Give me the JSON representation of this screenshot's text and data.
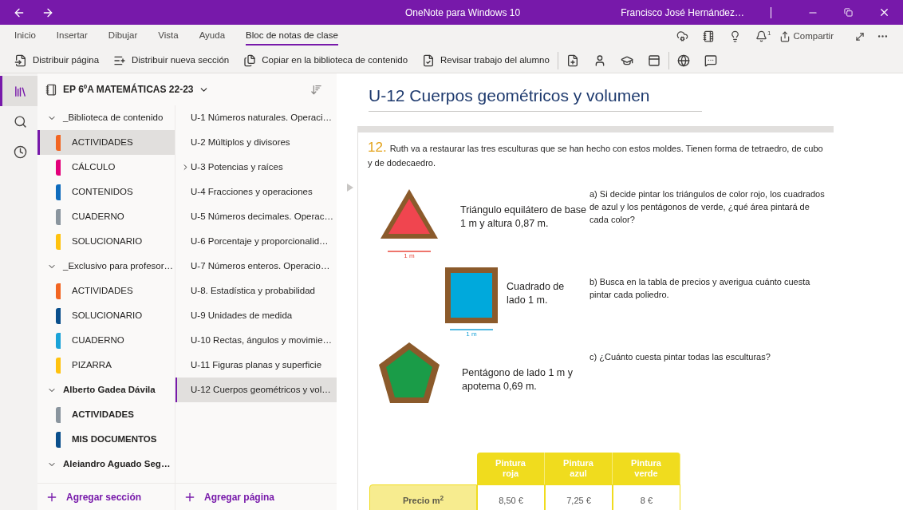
{
  "window": {
    "title": "OneNote para Windows 10",
    "user": "Francisco José Hernández…"
  },
  "menu_tabs": [
    {
      "label": "Inicio",
      "selected": false
    },
    {
      "label": "Insertar",
      "selected": false
    },
    {
      "label": "Dibujar",
      "selected": false
    },
    {
      "label": "Vista",
      "selected": false
    },
    {
      "label": "Ayuda",
      "selected": false
    },
    {
      "label": "Bloc de notas de clase",
      "selected": true
    }
  ],
  "notification_count": "1",
  "share_label": "Compartir",
  "ribbon": [
    {
      "kind": "distribute-page",
      "label": "Distribuir página"
    },
    {
      "kind": "distribute-section",
      "label": "Distribuir nueva sección"
    },
    {
      "kind": "copy-library",
      "label": "Copiar en la biblioteca de contenido"
    },
    {
      "kind": "review",
      "label": "Revisar trabajo del alumno"
    }
  ],
  "rail": [
    {
      "kind": "notebooks",
      "selected": true
    },
    {
      "kind": "search",
      "selected": false
    },
    {
      "kind": "recent",
      "selected": false
    }
  ],
  "notebook": {
    "name": "EP 6ºA MATEMÁTICAS 22-23"
  },
  "section_groups": [
    {
      "label": "_Biblioteca de contenido",
      "expanded": true,
      "unread": false,
      "children": [
        {
          "label": "ACTIVIDADES",
          "color": "#f26522",
          "selected": true,
          "unread": false
        },
        {
          "label": "CÁLCULO",
          "color": "#e3007a",
          "selected": false,
          "unread": false
        },
        {
          "label": "CONTENIDOS",
          "color": "#0f6cbd",
          "selected": false,
          "unread": false
        },
        {
          "label": "CUADERNO",
          "color": "#8a959e",
          "selected": false,
          "unread": false
        },
        {
          "label": "SOLUCIONARIO",
          "color": "#ffc20e",
          "selected": false,
          "unread": false
        }
      ]
    },
    {
      "label": "_Exclusivo para profesor…",
      "expanded": true,
      "unread": false,
      "children": [
        {
          "label": "ACTIVIDADES",
          "color": "#f26522",
          "selected": false,
          "unread": false
        },
        {
          "label": "SOLUCIONARIO",
          "color": "#0a4f8c",
          "selected": false,
          "unread": false
        },
        {
          "label": "CUADERNO",
          "color": "#1aa3d8",
          "selected": false,
          "unread": false
        },
        {
          "label": "PIZARRA",
          "color": "#ffc20e",
          "selected": false,
          "unread": false
        }
      ]
    },
    {
      "label": "Alberto Gadea Dávila",
      "expanded": true,
      "unread": true,
      "children": [
        {
          "label": "ACTIVIDADES",
          "color": "#8a959e",
          "selected": false,
          "unread": true
        },
        {
          "label": "MIS DOCUMENTOS",
          "color": "#0a4f8c",
          "selected": false,
          "unread": true
        }
      ]
    },
    {
      "label": "Aleiandro Aguado Seg…",
      "expanded": true,
      "unread": true
    }
  ],
  "add_section": "Agregar sección",
  "pages": [
    {
      "label": "U-1 Números naturales. Operaci…",
      "selected": false,
      "collapsed_subpages": false
    },
    {
      "label": "U-2 Múltiplos y divisores",
      "selected": false,
      "collapsed_subpages": false
    },
    {
      "label": "U-3 Potencias y raíces",
      "selected": false,
      "collapsed_subpages": true
    },
    {
      "label": "U-4 Fracciones y operaciones",
      "selected": false,
      "collapsed_subpages": false
    },
    {
      "label": "U-5 Números decimales. Operac…",
      "selected": false,
      "collapsed_subpages": false
    },
    {
      "label": "U-6 Porcentaje y proporcionalid…",
      "selected": false,
      "collapsed_subpages": false
    },
    {
      "label": "U-7 Números enteros. Operacio…",
      "selected": false,
      "collapsed_subpages": false
    },
    {
      "label": "U-8. Estadística y probabilidad",
      "selected": false,
      "collapsed_subpages": false
    },
    {
      "label": "U-9 Unidades de medida",
      "selected": false,
      "collapsed_subpages": false
    },
    {
      "label": "U-10 Rectas, ángulos y movimie…",
      "selected": false,
      "collapsed_subpages": false
    },
    {
      "label": "U-11 Figuras planas y superficie",
      "selected": false,
      "collapsed_subpages": false
    },
    {
      "label": "U-12 Cuerpos geométricos y vol…",
      "selected": true,
      "collapsed_subpages": false
    }
  ],
  "add_page": "Agregar página",
  "page": {
    "title": "U-12 Cuerpos geométricos y volumen",
    "exercise_number": "12.",
    "statement": "Ruth va a restaurar las tres esculturas que se han hecho con estos moldes. Tienen forma de tetraedro, de cubo y de dodecaedro.",
    "rows": [
      {
        "kind": "triangle",
        "caption": "Triángulo equilátero de base 1 m y altura 0,87 m.",
        "measure": "1 m",
        "question": "a) Si decide pintar los triángulos de color rojo, los cuadrados de azul y los pentágonos de verde, ¿qué área pintará de cada color?"
      },
      {
        "kind": "square",
        "caption": "Cuadrado de lado 1 m.",
        "measure": "1 m",
        "question": "b) Busca en la tabla de precios y averigua cuánto cuesta pintar cada poliedro."
      },
      {
        "kind": "pentagon",
        "caption": "Pentágono de lado 1 m y apotema 0,69 m.",
        "question": "c) ¿Cuánto cuesta pintar todas las esculturas?"
      }
    ],
    "price_table": {
      "columns": [
        "Pintura roja",
        "Pintura azul",
        "Pintura verde"
      ],
      "row_label": "Precio m$^{2}$",
      "values": [
        "8,50 €",
        "7,25 €",
        "8 €"
      ]
    }
  }
}
